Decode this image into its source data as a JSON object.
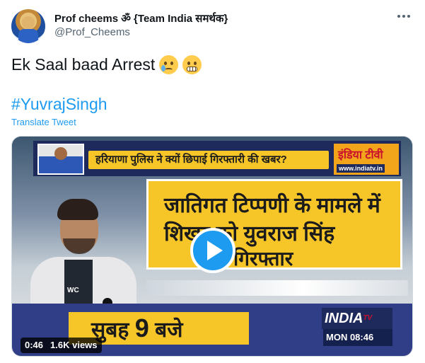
{
  "author": {
    "display_name": "Prof cheems ॐ {Team India समर्थक}",
    "handle": "@Prof_Cheems"
  },
  "tweet": {
    "text": "Ek Saal baad Arrest",
    "emojis": [
      "sad-but-relieved-face",
      "grimacing-face"
    ],
    "hashtag": "#YuvrajSingh",
    "translate_label": "Translate Tweet"
  },
  "video": {
    "duration": "0:46",
    "views": "1.6K views",
    "frame": {
      "top_banner": "हरियाणा पुलिस ने क्यों छिपाई गिरफ्तारी की खबर?",
      "channel_logo_top": "इंडिया टीवी",
      "channel_url": "www.indiatv.in",
      "headline_line1": "जातिगत टिप्पणी के मामले में",
      "headline_line2": "शिखर को युवराज सिंह",
      "headline_line3": "गिरफ्तार",
      "shirt_text": "WC",
      "ticker_prefix": "सुबह",
      "ticker_number": "9",
      "ticker_suffix": "बजे",
      "channel_logo_bottom": "INDIA",
      "channel_logo_bottom_sup": "TV",
      "clock": "MON 08:46"
    }
  },
  "colors": {
    "link": "#1d9bf0",
    "text": "#0f1419",
    "secondary": "#536471",
    "banner_yellow": "#f6c629",
    "banner_blue": "#2f3e86"
  }
}
